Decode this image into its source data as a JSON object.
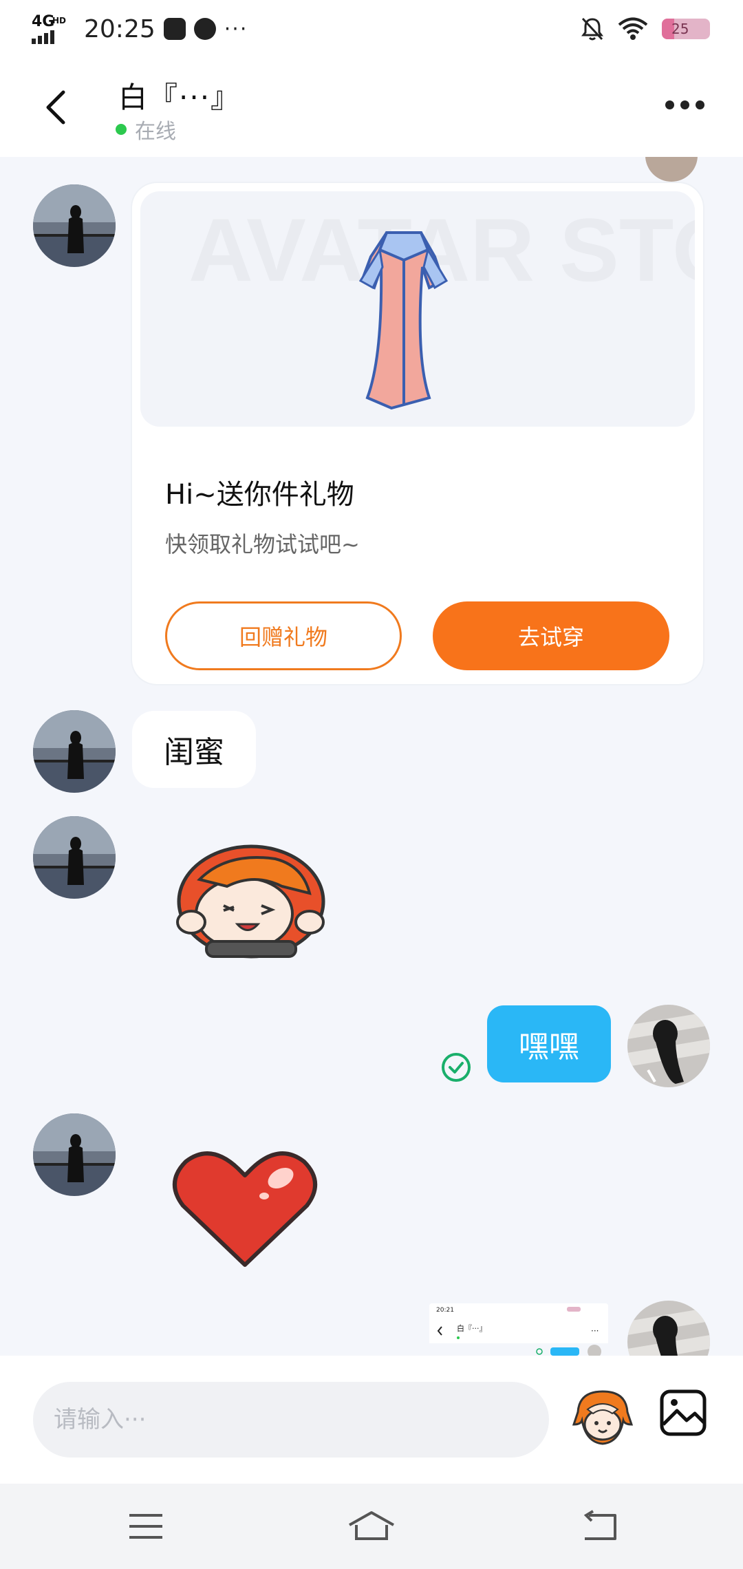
{
  "status_bar": {
    "network": "4G",
    "network_badge": "HD",
    "time": "20:25",
    "more": "···",
    "battery": "25",
    "icons": [
      "signal-icon",
      "mail-icon",
      "planet-icon",
      "mute-bell-icon",
      "wifi-icon",
      "battery-icon"
    ]
  },
  "header": {
    "title": "白『···』",
    "status": "在线",
    "status_color": "#2cc94e"
  },
  "messages": {
    "gift_card": {
      "image_label": "AVATAR STORE",
      "title": "Hi~送你件礼物",
      "subtitle": "快领取礼物试试吧~",
      "button_return": "回赠礼物",
      "button_try": "去试穿",
      "accent": "#f8731a"
    },
    "peer_text": "闺蜜",
    "my_text": "嘿嘿",
    "my_bubble_color": "#2ab7f6",
    "thumbnail": {
      "time": "20:21",
      "title": "白『···』",
      "more": "···"
    }
  },
  "input_bar": {
    "placeholder": "请输入···"
  }
}
